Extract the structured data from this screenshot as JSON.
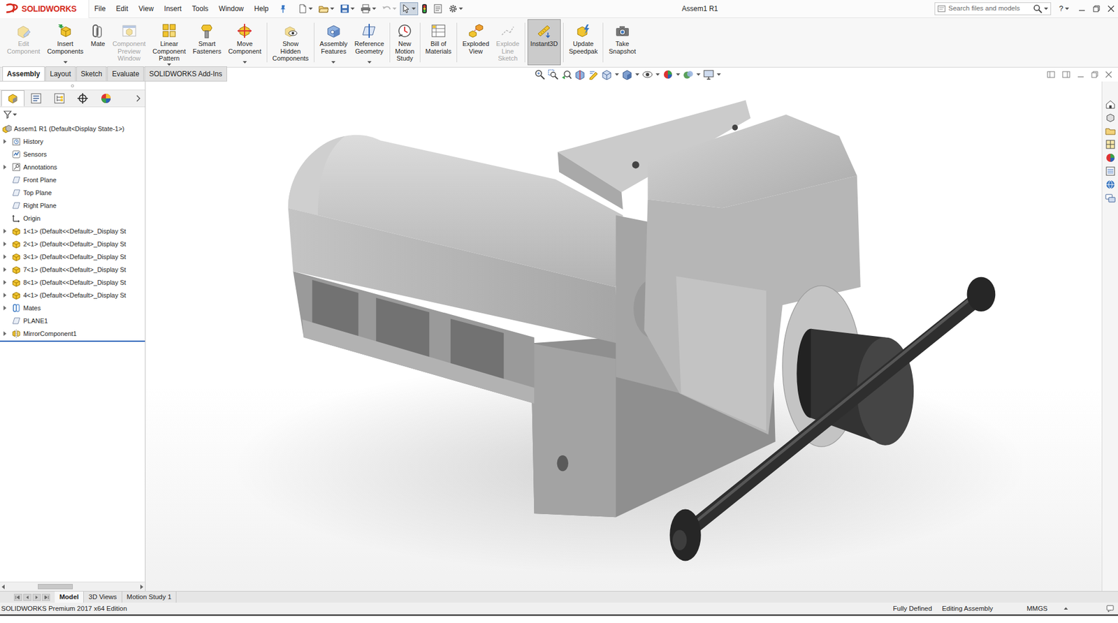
{
  "app": {
    "logo": "SOLIDWORKS"
  },
  "menu": [
    "File",
    "Edit",
    "View",
    "Insert",
    "Tools",
    "Window",
    "Help"
  ],
  "quick_access": [
    {
      "selected": false,
      "disabled": false,
      "dropdown": true
    },
    {
      "selected": false,
      "disabled": false,
      "dropdown": true
    },
    {
      "selected": false,
      "disabled": false,
      "dropdown": true
    },
    {
      "selected": false,
      "disabled": false,
      "dropdown": true
    },
    {
      "selected": false,
      "disabled": true,
      "dropdown": true
    },
    {
      "selected": true,
      "disabled": false,
      "dropdown": true
    },
    {
      "selected": false,
      "disabled": false,
      "dropdown": false
    },
    {
      "selected": false,
      "disabled": false,
      "dropdown": false
    },
    {
      "selected": false,
      "disabled": false,
      "dropdown": true
    }
  ],
  "window": {
    "title": "Assem1 R1"
  },
  "search": {
    "placeholder": "Search files and models"
  },
  "help": {
    "label": "?"
  },
  "ribbon": [
    [
      {
        "label": "Edit Component",
        "disabled": true,
        "selected": false,
        "dropdown": false
      },
      {
        "label": "Insert Components",
        "disabled": false,
        "selected": false,
        "dropdown": true
      },
      {
        "label": "Mate",
        "disabled": false,
        "selected": false,
        "dropdown": false
      },
      {
        "label": "Component Preview Window",
        "disabled": true,
        "selected": false,
        "dropdown": false
      },
      {
        "label": "Linear Component Pattern",
        "disabled": false,
        "selected": false,
        "dropdown": true
      },
      {
        "label": "Smart Fasteners",
        "disabled": false,
        "selected": false,
        "dropdown": false
      },
      {
        "label": "Move Component",
        "disabled": false,
        "selected": false,
        "dropdown": true
      }
    ],
    [
      {
        "label": "Show Hidden Components",
        "disabled": false,
        "selected": false,
        "dropdown": false
      }
    ],
    [
      {
        "label": "Assembly Features",
        "disabled": false,
        "selected": false,
        "dropdown": true
      },
      {
        "label": "Reference Geometry",
        "disabled": false,
        "selected": false,
        "dropdown": true
      }
    ],
    [
      {
        "label": "New Motion Study",
        "disabled": false,
        "selected": false,
        "dropdown": false
      }
    ],
    [
      {
        "label": "Bill of Materials",
        "disabled": false,
        "selected": false,
        "dropdown": false
      }
    ],
    [
      {
        "label": "Exploded View",
        "disabled": false,
        "selected": false,
        "dropdown": false
      },
      {
        "label": "Explode Line Sketch",
        "disabled": true,
        "selected": false,
        "dropdown": false
      }
    ],
    [
      {
        "label": "Instant3D",
        "disabled": false,
        "selected": true,
        "dropdown": false
      }
    ],
    [
      {
        "label": "Update Speedpak",
        "disabled": false,
        "selected": false,
        "dropdown": false
      }
    ],
    [
      {
        "label": "Take Snapshot",
        "disabled": false,
        "selected": false,
        "dropdown": false
      }
    ]
  ],
  "tabs": [
    {
      "label": "Assembly",
      "selected": true
    },
    {
      "label": "Layout",
      "selected": false
    },
    {
      "label": "Sketch",
      "selected": false
    },
    {
      "label": "Evaluate",
      "selected": false
    },
    {
      "label": "SOLIDWORKS Add-Ins",
      "selected": false
    }
  ],
  "panel_tabs": [
    {
      "selected": true
    },
    {
      "selected": false
    },
    {
      "selected": false
    },
    {
      "selected": false
    },
    {
      "selected": false
    }
  ],
  "tree": {
    "root": {
      "label": "Assem1 R1  (Default<Display State-1>)"
    },
    "items": [
      {
        "label": "History",
        "kind": "history",
        "expandable": true
      },
      {
        "label": "Sensors",
        "kind": "sensor",
        "expandable": false
      },
      {
        "label": "Annotations",
        "kind": "annotation",
        "expandable": true
      },
      {
        "label": "Front Plane",
        "kind": "plane",
        "expandable": false
      },
      {
        "label": "Top Plane",
        "kind": "plane",
        "expandable": false
      },
      {
        "label": "Right Plane",
        "kind": "plane",
        "expandable": false
      },
      {
        "label": "Origin",
        "kind": "origin",
        "expandable": false
      },
      {
        "label": "1<1> (Default<<Default>_Display St",
        "kind": "part",
        "expandable": true
      },
      {
        "label": "2<1> (Default<<Default>_Display St",
        "kind": "part",
        "expandable": true
      },
      {
        "label": "3<1> (Default<<Default>_Display St",
        "kind": "part",
        "expandable": true
      },
      {
        "label": "7<1> (Default<<Default>_Display St",
        "kind": "part",
        "expandable": true
      },
      {
        "label": "8<1> (Default<<Default>_Display St",
        "kind": "part",
        "expandable": true
      },
      {
        "label": "4<1> (Default<<Default>_Display St",
        "kind": "part",
        "expandable": true
      },
      {
        "label": "Mates",
        "kind": "mates",
        "expandable": true
      },
      {
        "label": "PLANE1",
        "kind": "plane",
        "expandable": false
      },
      {
        "label": "MirrorComponent1",
        "kind": "mirror",
        "expandable": true
      }
    ]
  },
  "bottom_tabs": [
    {
      "label": "Model",
      "selected": true
    },
    {
      "label": "3D Views",
      "selected": false
    },
    {
      "label": "Motion Study 1",
      "selected": false
    }
  ],
  "status_bar": {
    "edition": "SOLIDWORKS Premium 2017 x64 Edition",
    "state": "Fully Defined",
    "mode": "Editing Assembly",
    "units": "MMGS"
  }
}
